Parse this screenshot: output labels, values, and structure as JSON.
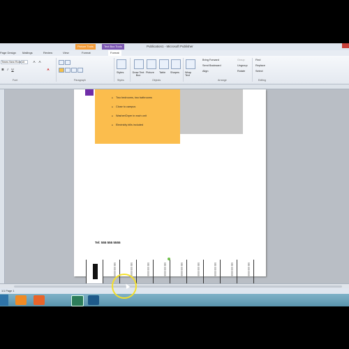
{
  "window": {
    "title": "Publication1 - Microsoft Publisher",
    "context_tabs": [
      "Picture Tools",
      "Text Box Tools"
    ]
  },
  "ribbon_tabs": [
    "Page Design",
    "Mailings",
    "Review",
    "View",
    "Format",
    "Format"
  ],
  "ribbon": {
    "font_name": "Times New Roman",
    "font_size": "10",
    "groups": [
      "Font",
      "Paragraph",
      "Styles",
      "Objects",
      "Arrange",
      "Editing"
    ],
    "buttons": {
      "styles": "Styles",
      "draw_text_box": "Draw Text Box",
      "picture": "Picture",
      "table": "Table",
      "shapes": "Shapes",
      "wrap_text": "Wrap Text",
      "bring_forward": "Bring Forward",
      "send_backward": "Send Backward",
      "align": "Align",
      "group": "Group",
      "ungroup": "Ungroup",
      "rotate": "Rotate",
      "find": "Find",
      "replace": "Replace",
      "select": "Select"
    }
  },
  "document": {
    "bullets": [
      "Two bedrooms, two bathrooms",
      "Close to campus",
      "Washer/Dryer in each unit",
      "Electricity bills included"
    ],
    "phone": "Tel: 555 555 5555",
    "tearoff_count": 10,
    "tearoff_text": "555 555 5555"
  },
  "status": {
    "left": "1/1 Page 1"
  },
  "taskbar": {
    "apps": [
      "media-player",
      "firefox",
      "publisher",
      "app"
    ]
  },
  "colors": {
    "orange_box": "#fbbd4d",
    "gray_box": "#c8c8c8",
    "purple_tab": "#6f2da8",
    "context_picture": "#f29b38",
    "context_textbox": "#7d59b3",
    "cursor_ring": "#f5e02a"
  }
}
